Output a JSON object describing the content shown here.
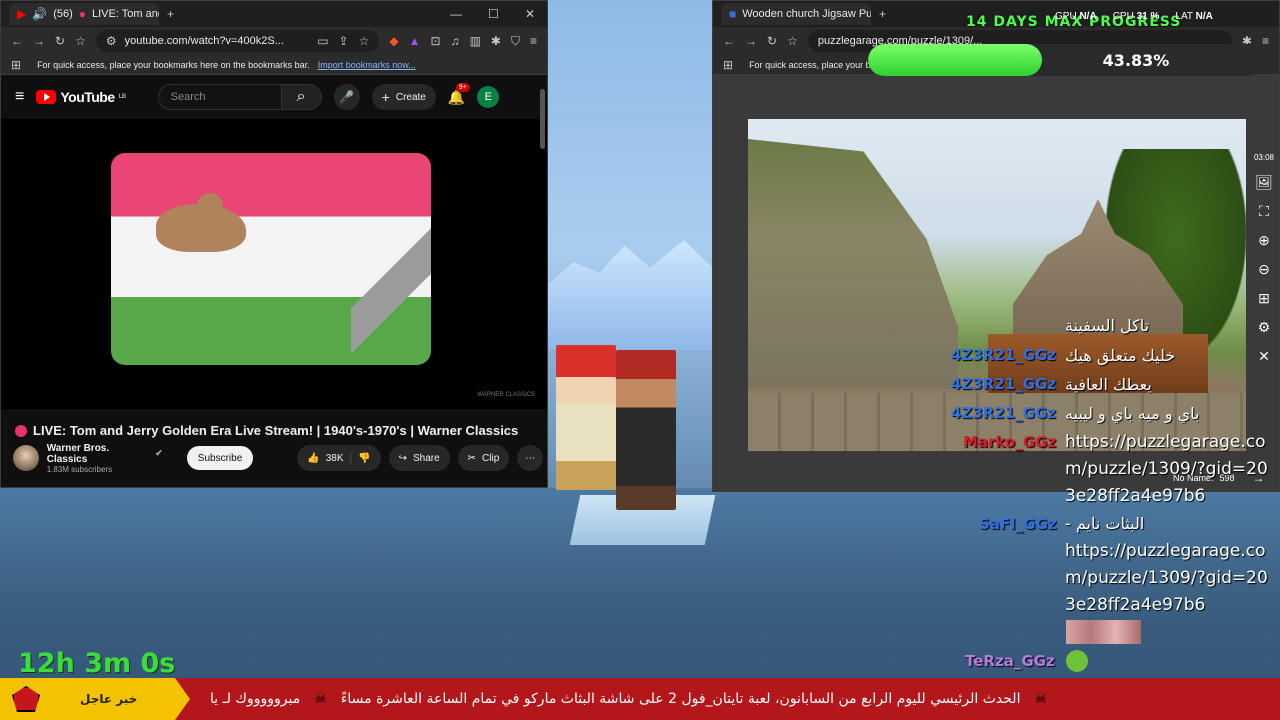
{
  "overlay": {
    "title": "14 DAYS MAX PROGRESS",
    "gpu_label": "GPU",
    "gpu_value": "N/A",
    "cpu_label": "CPU",
    "cpu_value": "31 %",
    "lat_label": "LAT",
    "lat_value": "N/A",
    "progress_text": "43.83%",
    "progress_value": 43.83,
    "timer": "12h 3m 0s"
  },
  "yt_window": {
    "tab_count": "(56)",
    "tab_title": "LIVE: Tom and Jerry G",
    "url": "youtube.com/watch?v=400k2S...",
    "bookmarks_hint": "For quick access, place your bookmarks here on the bookmarks bar.",
    "import_link": "Import bookmarks now...",
    "logo": "YouTube",
    "logo_badge": "LB",
    "search_placeholder": "Search",
    "create_label": "Create",
    "notif_count": "9+",
    "avatar_letter": "E",
    "watermark": "WARNER CLASSICS",
    "video_title": "LIVE: Tom and Jerry Golden Era Live Stream! | 1940's-1970's | Warner Classics",
    "channel_name": "Warner Bros. Classics",
    "subscribers": "1.83M subscribers",
    "subscribe_label": "Subscribe",
    "likes": "38K",
    "share_label": "Share",
    "clip_label": "Clip"
  },
  "pz_window": {
    "tab_title": "Wooden church Jigsaw Puzzle (",
    "url": "puzzlegarage.com/puzzle/1309/...",
    "bookmarks_hint": "For quick access, place your book",
    "time": "03:08",
    "player_label": "No Name:",
    "player_score": "598"
  },
  "chat": {
    "msg1": "تاكل السفينة",
    "user1": "4Z3R21_GGz",
    "msg2": "خليك متعلق هيك",
    "user2": "4Z3R21_GGz",
    "msg3": "يعطك العافية",
    "user3": "4Z3R21_GGz",
    "msg4": "باي و ميه باي و ليبيه",
    "user4": "Marko_GGz",
    "link1": "https://puzzlegarage.com/puzzle/1309/?gid=203e28ff2a4e97b6",
    "user5": "SaFI_GGz",
    "msg5": "- البثات نايم",
    "link2": "https://puzzlegarage.com/puzzle/1309/?gid=203e28ff2a4e97b6",
    "user6": "TeRza_GGz"
  },
  "ticker": {
    "label": "خبر عاجل",
    "text1": "الحدث الرئيسي لليوم الرابع من السابانون، لعبة تايتان_فول 2 على شاشة البثاث ماركو في تمام الساعة العاشرة مساءً",
    "text2": "مبروووووك لـ يا"
  },
  "colors": {
    "progress_fill": "#2fd02f",
    "title_green": "#4cff4c",
    "user_blue": "#2f6fe0",
    "user_red": "#d91c2c",
    "user_purple": "#b57be0",
    "ticker_red": "#b3171c",
    "ticker_yellow": "#f5c200"
  }
}
